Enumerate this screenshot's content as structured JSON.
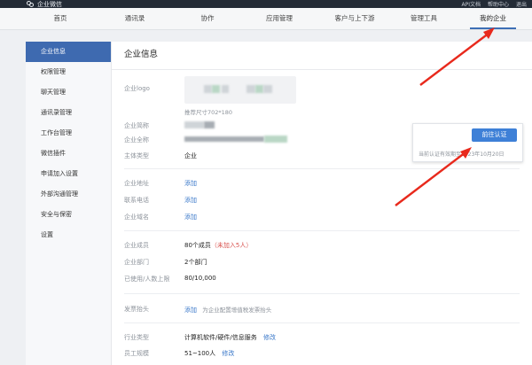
{
  "app": {
    "name": "企业微信"
  },
  "top_links": [
    "API文档",
    "帮助中心",
    "退出"
  ],
  "nav": [
    {
      "label": "首页"
    },
    {
      "label": "通讯录"
    },
    {
      "label": "协作"
    },
    {
      "label": "应用管理"
    },
    {
      "label": "客户与上下游"
    },
    {
      "label": "管理工具"
    },
    {
      "label": "我的企业"
    }
  ],
  "sidebar": {
    "items": [
      {
        "label": "企业信息"
      },
      {
        "label": "权限管理"
      },
      {
        "label": "聊天管理"
      },
      {
        "label": "通讯录管理"
      },
      {
        "label": "工作台管理"
      },
      {
        "label": "微信插件"
      },
      {
        "label": "申请加入设置"
      },
      {
        "label": "外部沟通管理"
      },
      {
        "label": "安全与保密"
      },
      {
        "label": "设置"
      }
    ]
  },
  "main": {
    "title": "企业信息",
    "logo_label": "企业logo",
    "logo_hint": "推荐尺寸702*180",
    "short_name_label": "企业简称",
    "full_name_label": "企业全称",
    "type_label": "主体类型",
    "type_value": "企业",
    "address_label": "企业地址",
    "phone_label": "联系电话",
    "domain_label": "企业域名",
    "add_link": "添加",
    "members_label": "企业成员",
    "members_value": "80个成员",
    "members_pending": "（未加入5人）",
    "depts_label": "企业部门",
    "depts_value": "2个部门",
    "usage_label": "已使用/人数上限",
    "usage_value": "80/10,000",
    "invoice_label": "发票抬头",
    "invoice_hint": "为企业配置增值税发票抬头",
    "industry_label": "行业类型",
    "industry_value": "计算机软件/硬件/信息服务",
    "edit_link": "修改",
    "scale_label": "员工规模",
    "scale_value": "51~100人"
  },
  "cert": {
    "button": "前往认证",
    "note": "当前认证有效期至2023年10月20日"
  },
  "colors": {
    "accent": "#3e6ab0",
    "annotation": "#e8291c"
  }
}
